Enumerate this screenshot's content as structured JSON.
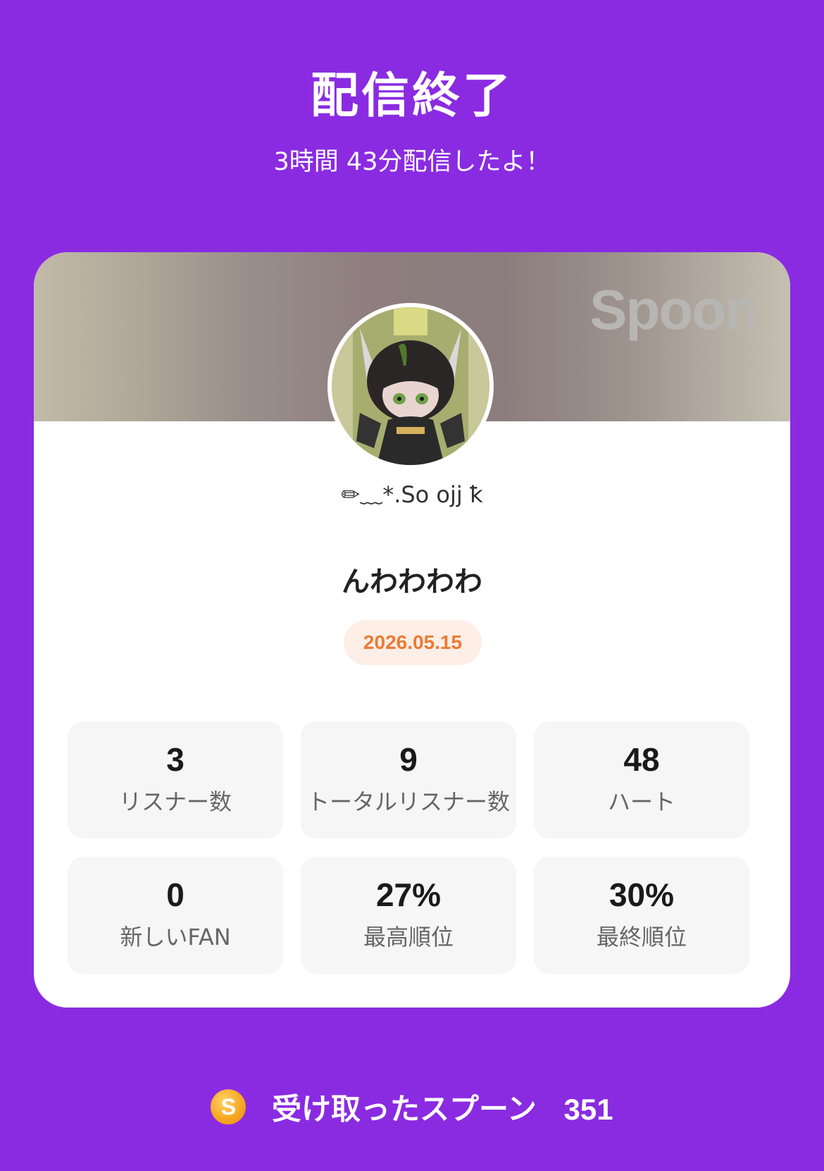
{
  "header": {
    "title": "配信終了",
    "subtitle": "3時間 43分配信したよ！"
  },
  "card": {
    "brand_logo": "Spoon",
    "username": "✏︎﹏*.So ojj ꝁ",
    "stream_title": "んわわわわ",
    "date": "2026.05.15"
  },
  "stats": [
    {
      "value": "3",
      "label": "リスナー数"
    },
    {
      "value": "9",
      "label": "トータルリスナー数"
    },
    {
      "value": "48",
      "label": "ハート"
    },
    {
      "value": "0",
      "label": "新しいFAN"
    },
    {
      "value": "27%",
      "label": "最高順位"
    },
    {
      "value": "30%",
      "label": "最終順位"
    }
  ],
  "footer": {
    "coin_glyph": "S",
    "received_label": "受け取ったスプーン",
    "received_count": "351"
  },
  "colors": {
    "background": "#8a2be2",
    "date_text": "#ea7b35",
    "coin": "#f6a821"
  }
}
